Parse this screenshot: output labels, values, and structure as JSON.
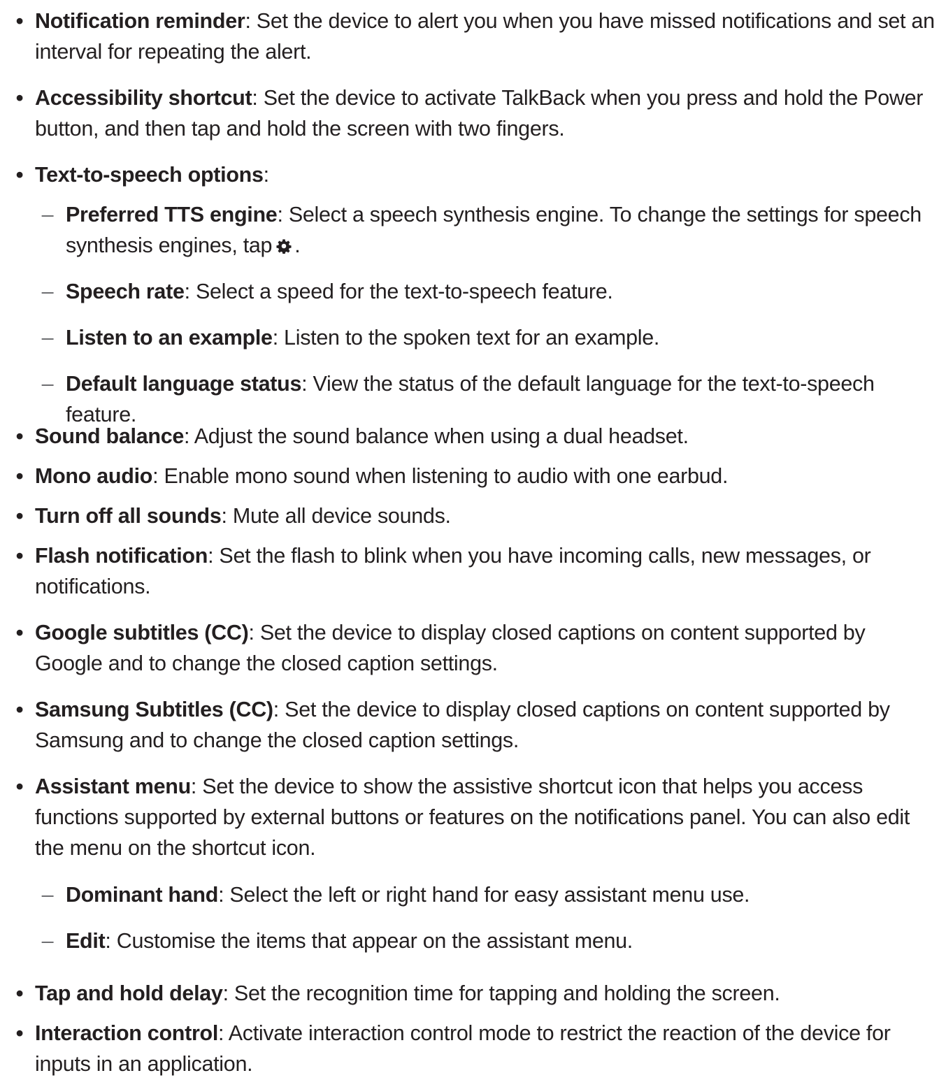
{
  "items": [
    {
      "term": "Notification reminder",
      "desc": ": Set the device to alert you when you have missed notifications and set an interval for repeating the alert."
    },
    {
      "term": "Accessibility shortcut",
      "desc": ": Set the device to activate TalkBack when you press and hold the Power button, and then tap and hold the screen with two fingers."
    },
    {
      "term": "Text-to-speech options",
      "desc": ":"
    },
    {
      "term": "Preferred TTS engine",
      "desc": ": Select a speech synthesis engine. To change the settings for speech synthesis engines, tap",
      "after_icon": ".",
      "icon": "gear-icon"
    },
    {
      "term": "Speech rate",
      "desc": ": Select a speed for the text-to-speech feature."
    },
    {
      "term": "Listen to an example",
      "desc": ": Listen to the spoken text for an example."
    },
    {
      "term": "Default language status",
      "desc": ": View the status of the default language for the text-to-speech feature."
    },
    {
      "term": "Sound balance",
      "desc": ": Adjust the sound balance when using a dual headset."
    },
    {
      "term": "Mono audio",
      "desc": ": Enable mono sound when listening to audio with one earbud."
    },
    {
      "term": "Turn off all sounds",
      "desc": ": Mute all device sounds."
    },
    {
      "term": "Flash notification",
      "desc": ": Set the flash to blink when you have incoming calls, new messages, or notifications."
    },
    {
      "term": "Google subtitles (CC)",
      "desc": ": Set the device to display closed captions on content supported by Google and to change the closed caption settings."
    },
    {
      "term": "Samsung Subtitles (CC)",
      "desc": ": Set the device to display closed captions on content supported by Samsung and to change the closed caption settings."
    },
    {
      "term": "Assistant menu",
      "desc": ": Set the device to show the assistive shortcut icon that helps you access functions supported by external buttons or features on the notifications panel. You can also edit the menu on the shortcut icon."
    },
    {
      "term": "Dominant hand",
      "desc": ": Select the left or right hand for easy assistant menu use."
    },
    {
      "term": "Edit",
      "desc": ": Customise the items that appear on the assistant menu."
    },
    {
      "term": "Tap and hold delay",
      "desc": ": Set the recognition time for tapping and holding the screen."
    },
    {
      "term": "Interaction control",
      "desc": ": Activate interaction control mode to restrict the reaction of the device for inputs in an application."
    }
  ],
  "bullets": {
    "main": "•",
    "sub": "–"
  },
  "colors": {
    "text": "#231f20",
    "sub_bullet": "#6d6e71"
  }
}
